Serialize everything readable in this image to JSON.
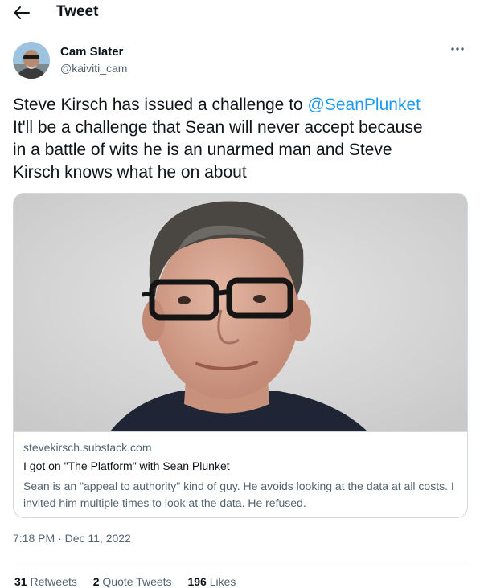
{
  "header": {
    "title": "Tweet",
    "back_icon": "arrow-left-icon"
  },
  "author": {
    "name": "Cam Slater",
    "handle": "@kaiviti_cam",
    "more_icon": "more-horizontal-icon"
  },
  "tweet": {
    "text_line1_before": "Steve Kirsch has issued a challenge to ",
    "mention": "@SeanPlunket",
    "text_line2": "It'll be a challenge that Sean will never accept because",
    "text_line3": "in a battle of wits he is an unarmed man and Steve",
    "text_line4": "Kirsch knows what he on about"
  },
  "card": {
    "domain": "stevekirsch.substack.com",
    "title": "I got on \"The Platform\" with Sean Plunket",
    "description": "Sean is an \"appeal to authority\" kind of guy. He avoids looking at the data at all costs. I invited him multiple times to look at the data. He refused."
  },
  "timestamp": {
    "time": "7:18 PM",
    "separator": " · ",
    "date": "Dec 11, 2022"
  },
  "stats": {
    "retweets": {
      "count": "31",
      "label": "Retweets"
    },
    "quotes": {
      "count": "2",
      "label": "Quote Tweets"
    },
    "likes": {
      "count": "196",
      "label": "Likes"
    }
  },
  "colors": {
    "accent": "#1d9bf0",
    "secondary_text": "#536471",
    "border": "#cfd9de"
  }
}
